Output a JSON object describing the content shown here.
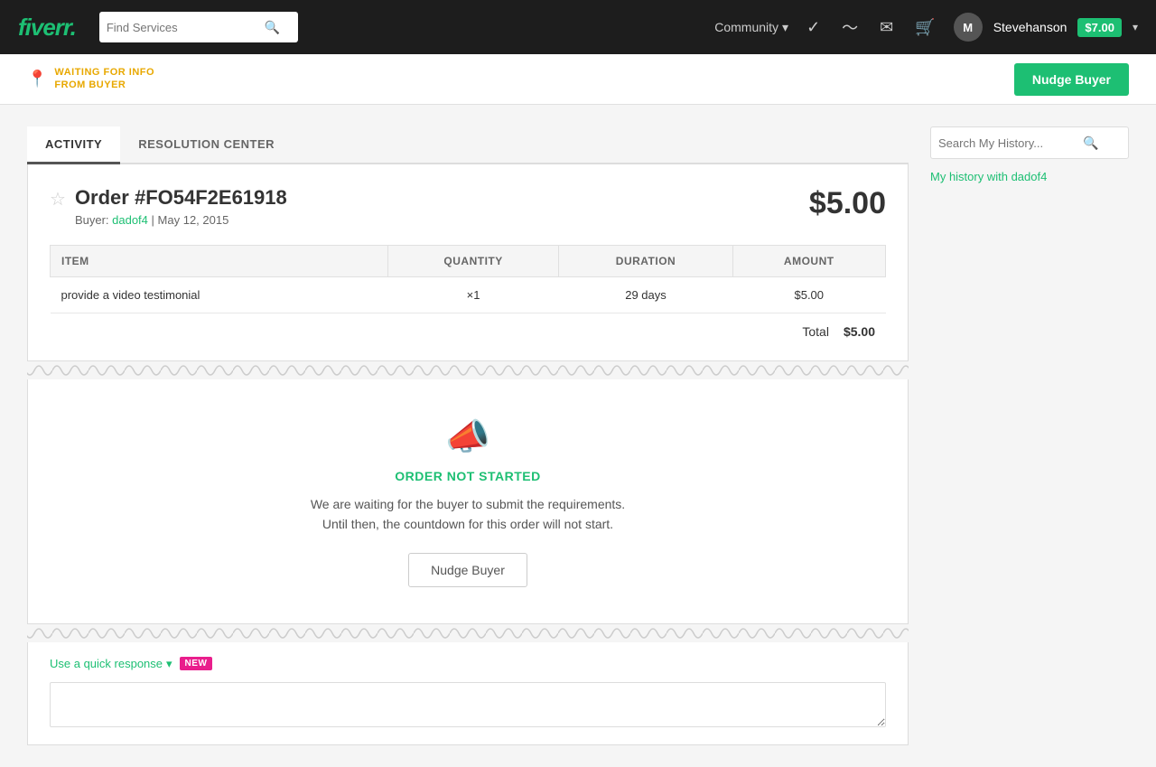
{
  "navbar": {
    "logo": "fiverr",
    "logo_accent": ".",
    "search_placeholder": "Find Services",
    "search_icon": "🔍",
    "community_label": "Community",
    "community_chevron": "▾",
    "check_icon": "✓",
    "analytics_icon": "∿",
    "message_icon": "✉",
    "cart_icon": "🛒",
    "avatar_initial": "M",
    "username": "Stevehanson",
    "balance": "$7.00",
    "dropdown_chevron": "▾"
  },
  "status_bar": {
    "pin_icon": "📍",
    "status_line1": "WAITING FOR INFO",
    "status_line2": "FROM BUYER",
    "nudge_button": "Nudge Buyer"
  },
  "tabs": [
    {
      "label": "ACTIVITY",
      "active": true
    },
    {
      "label": "RESOLUTION CENTER",
      "active": false
    }
  ],
  "order": {
    "star_icon": "☆",
    "title": "Order #FO54F2E61918",
    "buyer_label": "Buyer:",
    "buyer_name": "dadof4",
    "separator": "|",
    "date": "May 12, 2015",
    "price": "$5.00",
    "table": {
      "headers": [
        "ITEM",
        "QUANTITY",
        "DURATION",
        "AMOUNT"
      ],
      "rows": [
        {
          "item": "provide a video testimonial",
          "quantity": "×1",
          "duration": "29 days",
          "amount": "$5.00"
        }
      ],
      "total_label": "Total",
      "total_value": "$5.00"
    }
  },
  "order_status": {
    "icon": "📣",
    "label": "ORDER NOT STARTED",
    "desc_line1": "We are waiting for the buyer to submit the requirements.",
    "desc_line2": "Until then, the countdown for this order will not start.",
    "nudge_button": "Nudge Buyer"
  },
  "quick_response": {
    "link_text": "Use a quick response",
    "chevron": "▾",
    "new_badge": "NEW",
    "input_placeholder": ""
  },
  "sidebar": {
    "search_placeholder": "Search My History...",
    "search_icon": "🔍",
    "history_link": "My history with dadof4"
  }
}
